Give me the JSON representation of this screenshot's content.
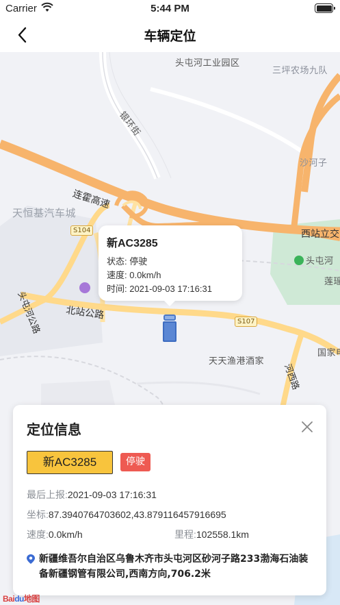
{
  "status_bar": {
    "carrier": "Carrier",
    "time": "5:44 PM"
  },
  "nav": {
    "title": "车辆定位"
  },
  "map": {
    "labels": {
      "park": "头屯河工业园区",
      "farm": "三坪农场九队",
      "yinhuan": "银环街",
      "lianhuo": "连霍高速",
      "tianheng": "天恒基汽车城",
      "s104": "S104",
      "s107": "S107",
      "shahezi": "沙河子",
      "xizhan_jct": "西站立交",
      "toutunhe": "头屯河",
      "lian": "莲瑶",
      "beizhan": "北站公路",
      "tiantian": "天天渔港酒家",
      "guojia": "国家电",
      "gaosu": "连霍高速",
      "toutunhe_road": "头屯河公路",
      "hexi": "河西路"
    }
  },
  "popup": {
    "plate": "新AC3285",
    "status": "状态: 停驶",
    "speed": "速度: 0.0km/h",
    "time": "时间: 2021-09-03 17:16:31"
  },
  "card": {
    "title": "定位信息",
    "plate": "新AC3285",
    "status": "停驶",
    "last_report_label": "最后上报:",
    "last_report_value": "2021-09-03 17:16:31",
    "coord_label": "坐标:",
    "coord_value": "87.3940764703602,43.879116457916695",
    "speed_label": "速度:",
    "speed_value": "0.0km/h",
    "mileage_label": "里程:",
    "mileage_value": "102558.1km",
    "address": "新疆维吾尔自治区乌鲁木齐市头屯河区砂河子路233渤海石油装备新疆钢管有限公司,西南方向,706.2米"
  },
  "logo": {
    "text": "Bai",
    "paw": "du",
    "suffix": "地图"
  },
  "colors": {
    "highway": "#f7b46c",
    "road": "#ffd98a",
    "park_green": "#cfe9d6",
    "badge_yellow": "#f8c43d",
    "badge_red": "#ee5a52"
  }
}
